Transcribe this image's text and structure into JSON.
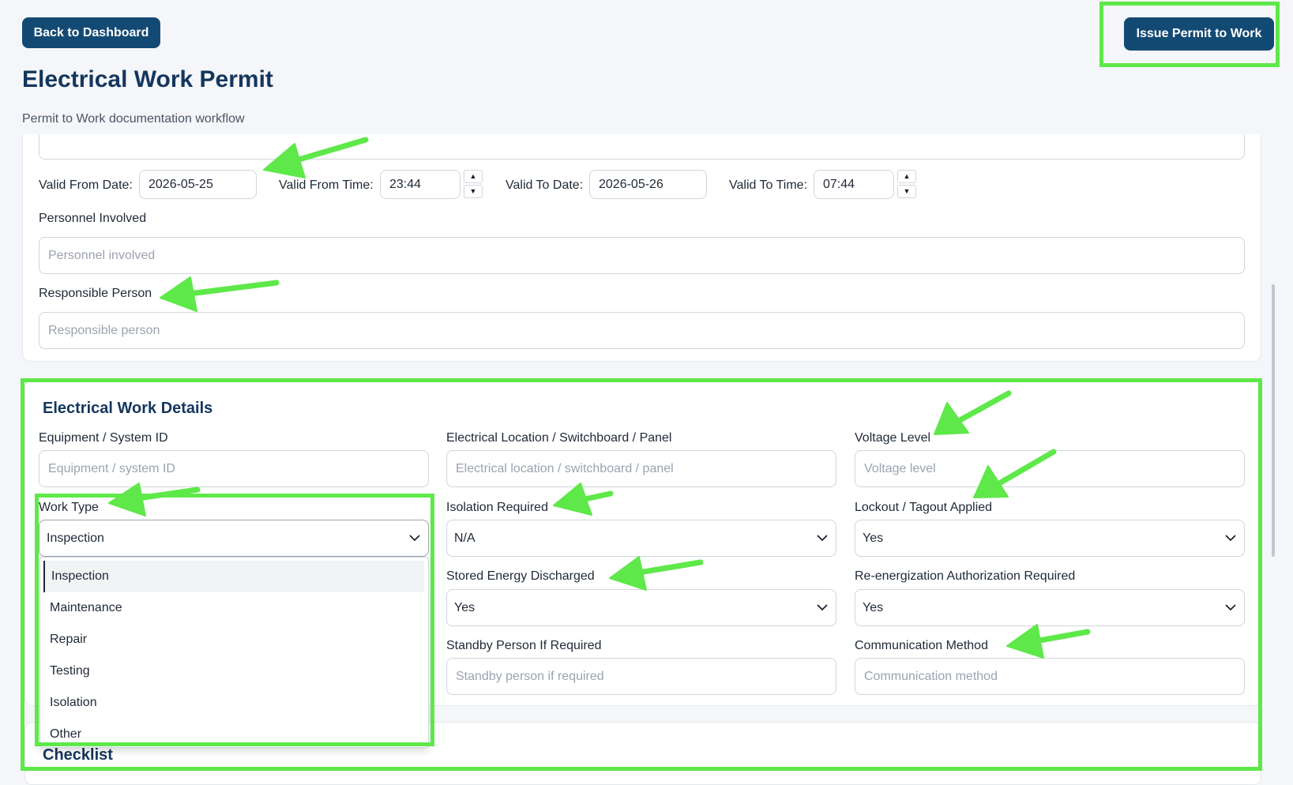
{
  "header": {
    "back_label": "Back to Dashboard",
    "issue_label": "Issue Permit to Work",
    "title": "Electrical Work Permit",
    "subtitle": "Permit to Work documentation workflow"
  },
  "validity": {
    "from_date_label": "Valid From Date:",
    "from_date_value": "2026-05-25",
    "from_time_label": "Valid From Time:",
    "from_time_value": "23:44",
    "to_date_label": "Valid To Date:",
    "to_date_value": "2026-05-26",
    "to_time_label": "Valid To Time:",
    "to_time_value": "07:44"
  },
  "personnel": {
    "label": "Personnel Involved",
    "placeholder": "Personnel involved"
  },
  "responsible": {
    "label": "Responsible Person",
    "placeholder": "Responsible person"
  },
  "electrical": {
    "title": "Electrical Work Details",
    "equipment_label": "Equipment / System ID",
    "equipment_placeholder": "Equipment / system ID",
    "location_label": "Electrical Location / Switchboard / Panel",
    "location_placeholder": "Electrical location / switchboard / panel",
    "voltage_label": "Voltage Level",
    "voltage_placeholder": "Voltage level",
    "work_type_label": "Work Type",
    "work_type_value": "Inspection",
    "work_type_options": [
      "Inspection",
      "Maintenance",
      "Repair",
      "Testing",
      "Isolation",
      "Other"
    ],
    "isolation_label": "Isolation Required",
    "isolation_value": "N/A",
    "lockout_label": "Lockout / Tagout Applied",
    "lockout_value": "Yes",
    "stored_energy_label": "Stored Energy Discharged",
    "stored_energy_value": "Yes",
    "reenergization_label": "Re-energization Authorization Required",
    "reenergization_value": "Yes",
    "standby_label": "Standby Person If Required",
    "standby_placeholder": "Standby person if required",
    "communication_label": "Communication Method",
    "communication_placeholder": "Communication method"
  },
  "checklist": {
    "title": "Checklist"
  },
  "icons": {
    "chevron": "chevron-down-icon",
    "spinner_up": "spinner-up-icon",
    "spinner_down": "spinner-down-icon",
    "arrow": "annotation-arrow-icon"
  },
  "colors": {
    "primary": "#134a73",
    "heading": "#14365d",
    "highlight": "#5ee849",
    "background": "#f4f6f9"
  }
}
